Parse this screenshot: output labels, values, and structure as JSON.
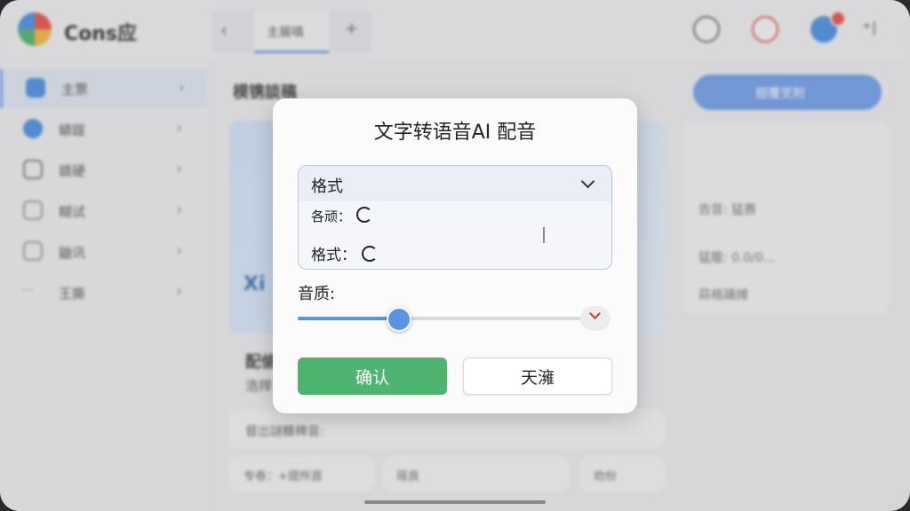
{
  "app": {
    "brand": "Cons应"
  },
  "tabs": {
    "active_label": "主展嗔",
    "back_glyph": "‹",
    "add_glyph": "+"
  },
  "toolbar": {
    "more_glyph": "⁺⁞"
  },
  "sidebar": {
    "items": [
      {
        "label": "主票",
        "icon": "home-icon",
        "color": "#4a8fe0"
      },
      {
        "label": "蟒跋",
        "icon": "chat-icon",
        "color": "#4a8fe0"
      },
      {
        "label": "赣硬",
        "icon": "heart-icon",
        "color": "#777777"
      },
      {
        "label": "糊试",
        "icon": "clock-icon",
        "color": "#999999"
      },
      {
        "label": "鼬讯",
        "icon": "doc-icon",
        "color": "#999999"
      },
      {
        "label": "王撕",
        "icon": "more-icon",
        "color": "#999999"
      }
    ]
  },
  "main": {
    "title": "模镌談稿",
    "image_text": "Xi",
    "card_title": "配偷",
    "card_subtitle": "浩捍",
    "row_text": "督岀謎糠稗音:",
    "pill1": "专卷：+提所首",
    "pill2": "瑶良",
    "pill3": "劝份"
  },
  "right": {
    "button_label": "翅覆芠附",
    "row1": "告音: 猛赛",
    "row2": "猛籠: 0.0/0...",
    "row3": "蒜格踊摊"
  },
  "dialog": {
    "title": "文字转语音AI 配音",
    "dropdown_value": "格式",
    "option1": "各顽：",
    "option2": "格式：",
    "quality_label": "音质:",
    "slider_value_pct": 35,
    "confirm_label": "确认",
    "cancel_label": "天澭"
  },
  "colors": {
    "accent": "#5b93e6",
    "confirm": "#4fb46f"
  }
}
